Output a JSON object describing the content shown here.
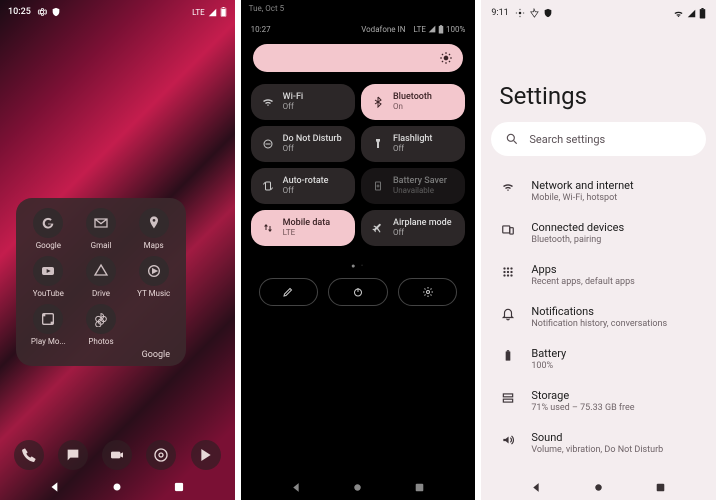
{
  "phone1": {
    "status": {
      "time": "10:25",
      "network_label": "LTE"
    },
    "folder": {
      "name": "Google",
      "apps": [
        {
          "label": "Google",
          "icon": "google-icon"
        },
        {
          "label": "Gmail",
          "icon": "gmail-icon"
        },
        {
          "label": "Maps",
          "icon": "maps-icon"
        },
        {
          "label": "YouTube",
          "icon": "youtube-icon"
        },
        {
          "label": "Drive",
          "icon": "drive-icon"
        },
        {
          "label": "YT Music",
          "icon": "ytmusic-icon"
        },
        {
          "label": "Play Mo...",
          "icon": "playmovies-icon"
        },
        {
          "label": "Photos",
          "icon": "photos-icon"
        }
      ]
    },
    "dock": [
      {
        "icon": "phone-icon"
      },
      {
        "icon": "messages-icon"
      },
      {
        "icon": "camera-icon"
      },
      {
        "icon": "chrome-icon"
      },
      {
        "icon": "playstore-icon"
      }
    ]
  },
  "phone2": {
    "date": "Tue, Oct 5",
    "time": "10:27",
    "carrier": "Vodafone IN",
    "network_label": "LTE",
    "battery_pct": "100%",
    "tiles": [
      {
        "title": "Wi-Fi",
        "sub": "Off",
        "on": false,
        "icon": "wifi-icon"
      },
      {
        "title": "Bluetooth",
        "sub": "On",
        "on": true,
        "icon": "bluetooth-icon"
      },
      {
        "title": "Do Not Disturb",
        "sub": "Off",
        "on": false,
        "icon": "dnd-icon"
      },
      {
        "title": "Flashlight",
        "sub": "Off",
        "on": false,
        "icon": "flashlight-icon"
      },
      {
        "title": "Auto-rotate",
        "sub": "Off",
        "on": false,
        "icon": "autorotate-icon"
      },
      {
        "title": "Battery Saver",
        "sub": "Unavailable",
        "on": false,
        "dim": true,
        "icon": "batterysaver-icon"
      },
      {
        "title": "Mobile data",
        "sub": "LTE",
        "on": true,
        "icon": "mobiledata-icon"
      },
      {
        "title": "Airplane mode",
        "sub": "Off",
        "on": false,
        "icon": "airplane-icon"
      }
    ]
  },
  "phone3": {
    "status": {
      "time": "9:11"
    },
    "title": "Settings",
    "search_placeholder": "Search settings",
    "items": [
      {
        "title": "Network and internet",
        "sub": "Mobile, Wi-Fi, hotspot",
        "icon": "wifi-icon"
      },
      {
        "title": "Connected devices",
        "sub": "Bluetooth, pairing",
        "icon": "devices-icon"
      },
      {
        "title": "Apps",
        "sub": "Recent apps, default apps",
        "icon": "apps-icon"
      },
      {
        "title": "Notifications",
        "sub": "Notification history, conversations",
        "icon": "bell-icon"
      },
      {
        "title": "Battery",
        "sub": "100%",
        "icon": "battery-icon"
      },
      {
        "title": "Storage",
        "sub": "71% used – 75.33 GB free",
        "icon": "storage-icon"
      },
      {
        "title": "Sound",
        "sub": "Volume, vibration, Do Not Disturb",
        "icon": "sound-icon"
      }
    ]
  }
}
